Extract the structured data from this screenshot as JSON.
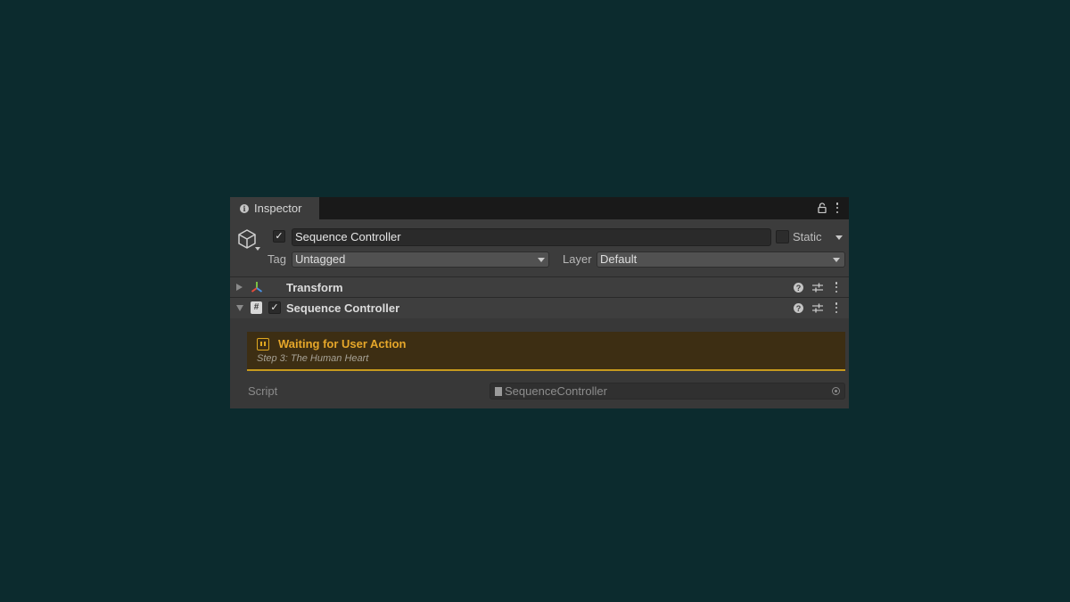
{
  "window": {
    "tab_label": "Inspector"
  },
  "gameobject": {
    "active": true,
    "name": "Sequence Controller",
    "static_label": "Static",
    "static_checked": false,
    "tag_label": "Tag",
    "tag_value": "Untagged",
    "layer_label": "Layer",
    "layer_value": "Default"
  },
  "components": [
    {
      "title": "Transform",
      "expanded": false,
      "icon": "transform-axes-icon"
    },
    {
      "title": "Sequence Controller",
      "expanded": true,
      "enabled": true,
      "icon": "csharp-script-icon"
    }
  ],
  "status_banner": {
    "title": "Waiting for User Action",
    "subtitle": "Step 3: The Human Heart",
    "accent_color": "#e0a81f",
    "icon": "pause-icon"
  },
  "script_field": {
    "label": "Script",
    "value": "SequenceController"
  },
  "colors": {
    "background": "#0c2b2e",
    "panel": "#383838"
  }
}
